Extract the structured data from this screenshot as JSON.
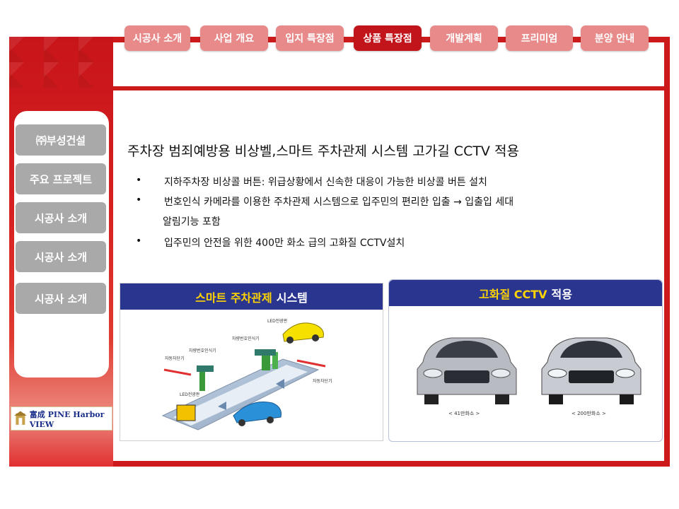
{
  "tabs": [
    {
      "label": "시공사 소개",
      "active": false
    },
    {
      "label": "사업 개요",
      "active": false
    },
    {
      "label": "입지 특장점",
      "active": false
    },
    {
      "label": "상품 특장점",
      "active": true
    },
    {
      "label": "개발계획",
      "active": false
    },
    {
      "label": "프리미엄",
      "active": false
    },
    {
      "label": "분양 안내",
      "active": false
    }
  ],
  "sidebar": {
    "items": [
      {
        "label": "㈜부성건설"
      },
      {
        "label": "주요 프로젝트"
      },
      {
        "label": "시공사 소개"
      },
      {
        "label": "시공사 소개"
      },
      {
        "label": "시공사 소개"
      }
    ],
    "logo_text": "富成 PINE Harbor VIEW"
  },
  "main": {
    "heading": "주차장 범죄예방용 비상벨,스마트 주차관제 시스템 고가길 CCTV 적용",
    "bullets": [
      {
        "text": "지하주차장 비상콜 버튼: 위급상황에서 신속한 대응이 가능한 비상콜 버튼 설치"
      },
      {
        "text": "번호인식 카메라를 이용한 주차관제 시스템으로 입주민의 편리한 입출 → 입출입 세대",
        "cont": "알림기능 포함"
      },
      {
        "text": "입주민의 안전을 위한 400만 화소 급의 고화질 CCTV설치"
      }
    ],
    "bullet_symbol": "•"
  },
  "panel_parking": {
    "title_yellow": "스마트 주차관제",
    "title_white": "시스템",
    "labels": [
      "LED전광판",
      "차량번호인식기",
      "차량번호인식기",
      "자동차단기",
      "LED전광판",
      "자동차단기"
    ]
  },
  "panel_cctv": {
    "title_yellow": "고화질 CCTV",
    "title_white": "적용",
    "captions": [
      "< 41만화소 >",
      "< 200만화소 >"
    ]
  },
  "colors": {
    "brand_red": "#cc1a1a",
    "tab_inactive": "#e88a8a",
    "tab_active": "#c2151b",
    "sidebar_button": "#a9a9a9",
    "panel_navy": "#2a3590",
    "panel_title_yellow": "#ffd400"
  }
}
